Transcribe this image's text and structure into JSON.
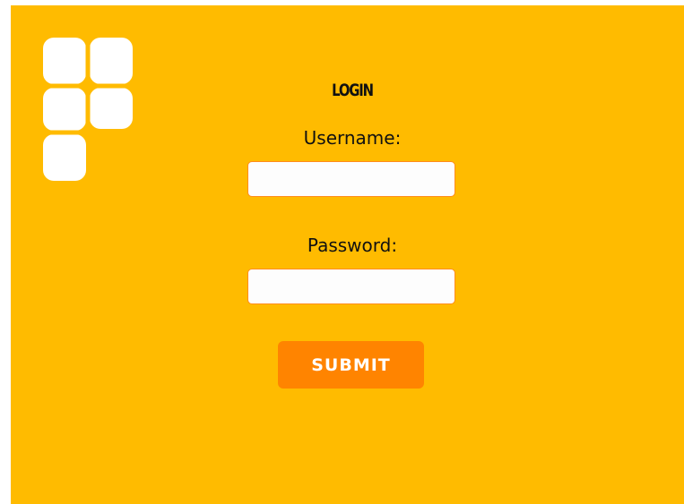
{
  "branding": {
    "logo_icon": "white-tiles-logo-icon",
    "logo_color": "#ffffff"
  },
  "colors": {
    "background": "#ffbb00",
    "accent": "#ff8400"
  },
  "login_form": {
    "title": "LOGIN",
    "username_label": "Username:",
    "username_value": "",
    "password_label": "Password:",
    "password_value": "",
    "submit_label": "SUBMIT"
  }
}
